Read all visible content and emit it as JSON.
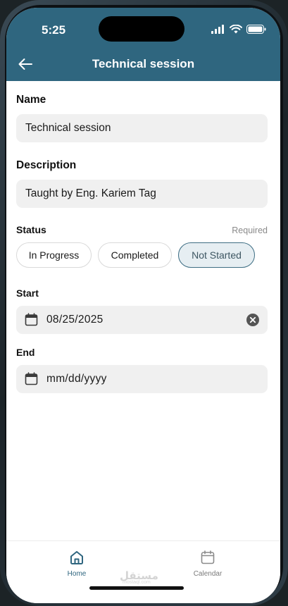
{
  "status_bar": {
    "time": "5:25"
  },
  "header": {
    "title": "Technical session",
    "back_icon": "arrow-left-icon"
  },
  "form": {
    "name": {
      "label": "Name",
      "value": "Technical session"
    },
    "description": {
      "label": "Description",
      "value": "Taught by Eng. Kariem Tag"
    },
    "status": {
      "label": "Status",
      "required_text": "Required",
      "options": [
        {
          "label": "In Progress",
          "selected": false
        },
        {
          "label": "Completed",
          "selected": false
        },
        {
          "label": "Not Started",
          "selected": true
        }
      ]
    },
    "start": {
      "label": "Start",
      "value": "08/25/2025"
    },
    "end": {
      "label": "End",
      "placeholder": "mm/dd/yyyy"
    }
  },
  "bottom_nav": {
    "items": [
      {
        "label": "Home",
        "icon": "home-icon",
        "active": true
      },
      {
        "label": "Calendar",
        "icon": "calendar-icon",
        "active": false
      }
    ]
  },
  "watermark": {
    "text": "مستقل",
    "sub": "mostaql.com"
  },
  "colors": {
    "header_bg": "#2f667f",
    "accent": "#2f667f",
    "chip_selected_bg": "#e6eef2",
    "input_bg": "#f0f0f0"
  }
}
